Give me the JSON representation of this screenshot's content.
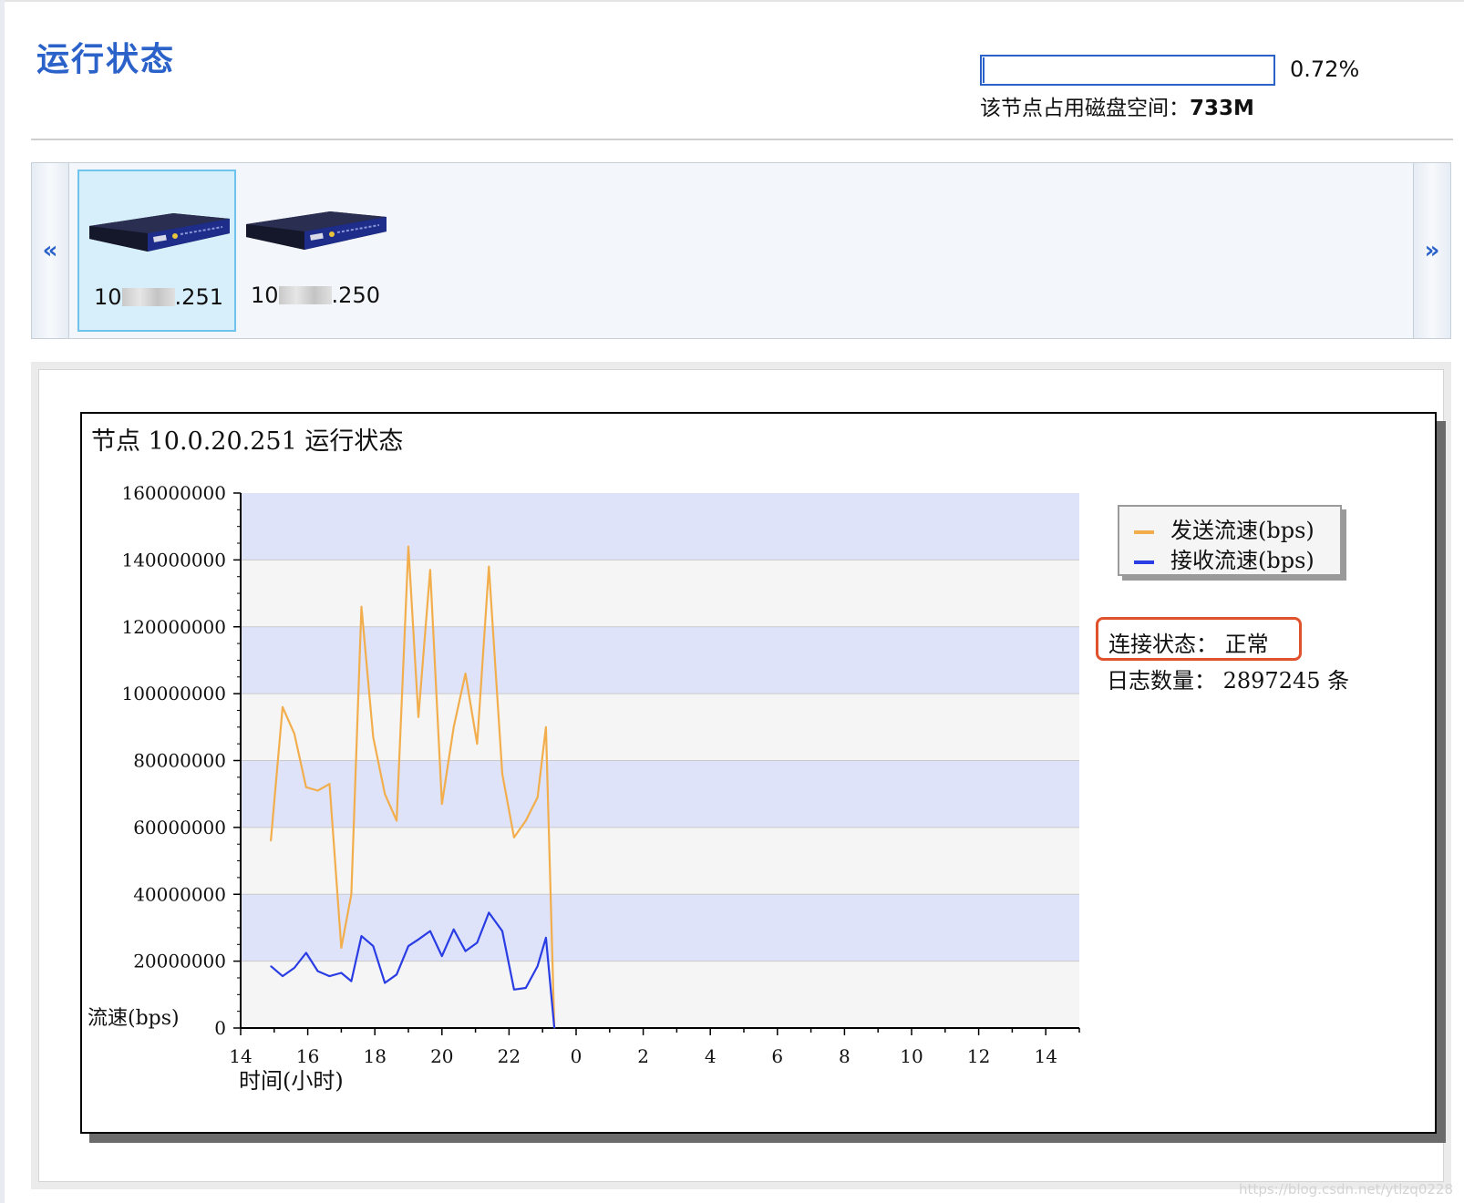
{
  "page": {
    "title": "运行状态",
    "disk": {
      "percent_text": "0.72%",
      "usage_fraction": 0.0072,
      "label": "该节点占用磁盘空间：",
      "value": "733M"
    }
  },
  "carousel": {
    "prev_label": "«",
    "next_label": "»",
    "nodes": [
      {
        "label_prefix": "10",
        "label_suffix": ".251",
        "selected": true
      },
      {
        "label_prefix": "10",
        "label_suffix": ".250",
        "selected": false
      }
    ]
  },
  "chart_panel": {
    "connection_status": "连接状态： 正常",
    "log_count": "日志数量： 2897245 条"
  },
  "chart_data": {
    "type": "line",
    "title": "节点 10.0.20.251 运行状态",
    "xlabel": "时间(小时)",
    "ylabel": "流速(bps)",
    "xlim": [
      14,
      39
    ],
    "ylim": [
      0,
      160000000
    ],
    "x_tick_labels": [
      "14",
      "16",
      "18",
      "20",
      "22",
      "0",
      "2",
      "4",
      "6",
      "8",
      "10",
      "12",
      "14"
    ],
    "y_tick_labels": [
      "160000000",
      "140000000",
      "120000000",
      "100000000",
      "80000000",
      "60000000",
      "40000000",
      "20000000",
      "0"
    ],
    "band_colors": [
      "#dee3fa",
      "#f5f5f5"
    ],
    "legend_position": "right",
    "series": [
      {
        "name": "发送流速(bps)",
        "color": "#f2ae4c",
        "x": [
          14.9,
          15.25,
          15.6,
          15.95,
          16.3,
          16.65,
          17.0,
          17.3,
          17.6,
          17.95,
          18.3,
          18.65,
          19.0,
          19.3,
          19.65,
          20.0,
          20.35,
          20.7,
          21.05,
          21.4,
          21.8,
          22.15,
          22.5,
          22.85,
          23.1,
          23.35
        ],
        "y": [
          56000000,
          96000000,
          88000000,
          72000000,
          71000000,
          73000000,
          24000000,
          40000000,
          126000000,
          87000000,
          70000000,
          62000000,
          144000000,
          93000000,
          137000000,
          67000000,
          90000000,
          106000000,
          85000000,
          138000000,
          76000000,
          57000000,
          62000000,
          69000000,
          90000000,
          0
        ]
      },
      {
        "name": "接收流速(bps)",
        "color": "#2a3de4",
        "x": [
          14.9,
          15.25,
          15.6,
          15.95,
          16.3,
          16.65,
          17.0,
          17.3,
          17.6,
          17.95,
          18.3,
          18.65,
          19.0,
          19.3,
          19.65,
          20.0,
          20.35,
          20.7,
          21.05,
          21.4,
          21.8,
          22.15,
          22.5,
          22.85,
          23.1,
          23.35
        ],
        "y": [
          18500000,
          15500000,
          18000000,
          22500000,
          17000000,
          15500000,
          16500000,
          14000000,
          27500000,
          24500000,
          13500000,
          16000000,
          24500000,
          26500000,
          29000000,
          21500000,
          29500000,
          23000000,
          25500000,
          34500000,
          29000000,
          11500000,
          12000000,
          18500000,
          27000000,
          0
        ]
      }
    ]
  }
}
